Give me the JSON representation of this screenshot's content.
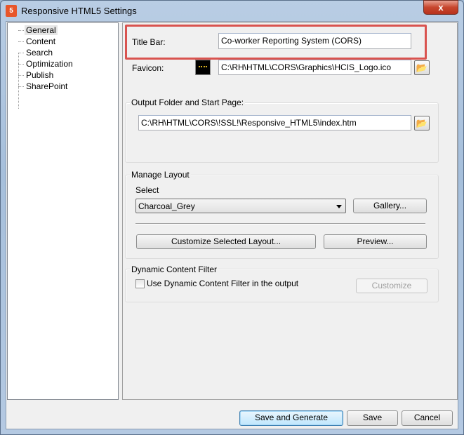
{
  "window": {
    "title": "Responsive HTML5 Settings",
    "close_label": "x",
    "icon": "html5-app-icon"
  },
  "tree": {
    "items": [
      {
        "label": "General",
        "selected": true
      },
      {
        "label": "Content"
      },
      {
        "label": "Search"
      },
      {
        "label": "Optimization"
      },
      {
        "label": "Publish"
      },
      {
        "label": "SharePoint"
      }
    ]
  },
  "general": {
    "title_bar_label": "Title Bar:",
    "title_bar_value": "Co-worker Reporting System (CORS)",
    "favicon_label": "Favicon:",
    "favicon_value": "C:\\RH\\HTML\\CORS\\Graphics\\HCIS_Logo.ico",
    "output_group_label": "Output Folder and Start Page:",
    "output_value": "C:\\RH\\HTML\\CORS\\!SSL!\\Responsive_HTML5\\index.htm",
    "layout_group_label": "Manage Layout",
    "select_label": "Select",
    "layout_selected": "Charcoal_Grey",
    "gallery_label": "Gallery...",
    "customize_layout_label": "Customize Selected Layout...",
    "preview_label": "Preview...",
    "dcf_group_label": "Dynamic Content Filter",
    "dcf_checkbox_label": "Use Dynamic Content Filter in the output",
    "dcf_checked": false,
    "dcf_customize_label": "Customize"
  },
  "footer": {
    "save_generate_label": "Save and Generate",
    "save_label": "Save",
    "cancel_label": "Cancel"
  },
  "colors": {
    "highlight_box": "#d9534f"
  }
}
